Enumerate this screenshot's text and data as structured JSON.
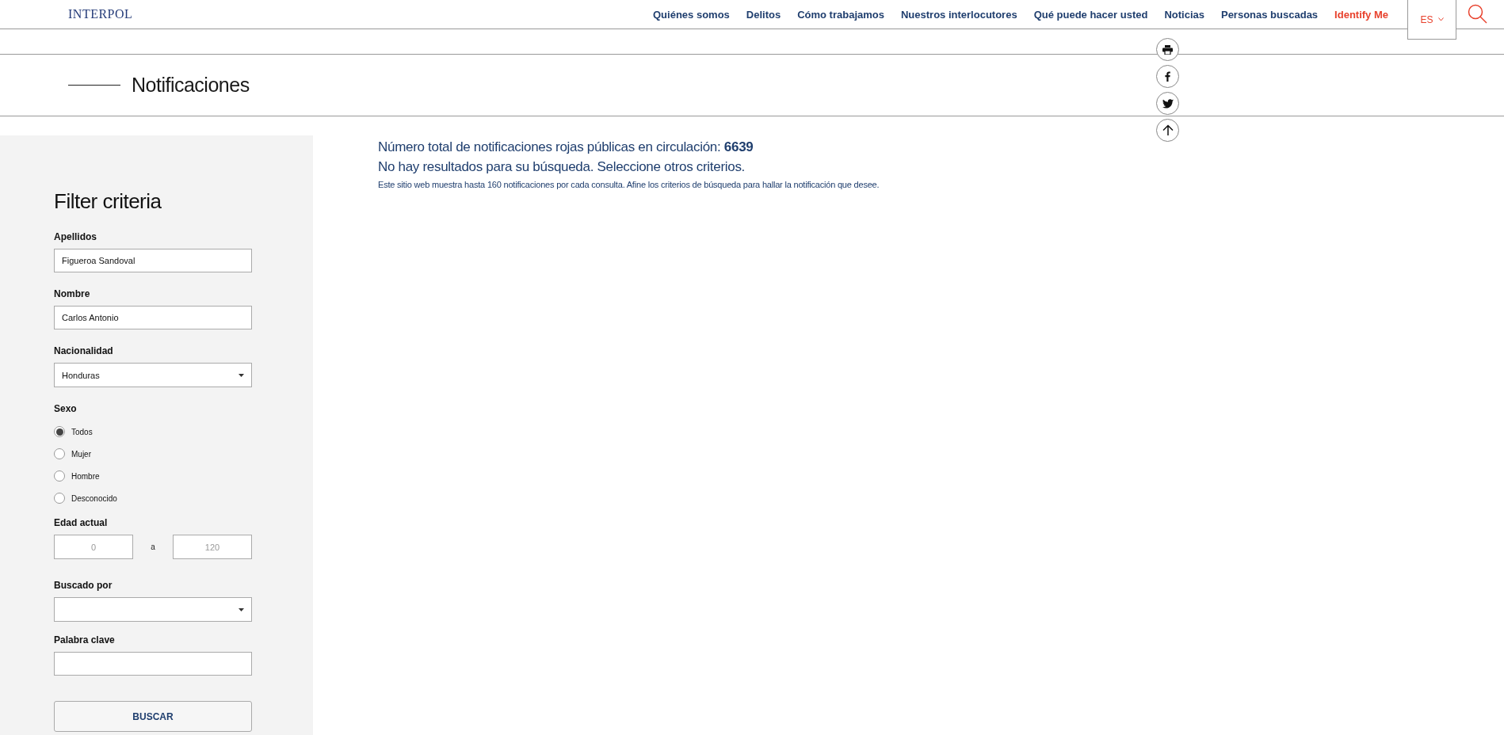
{
  "header": {
    "logo": "INTERPOL",
    "nav": [
      {
        "label": "Quiénes somos",
        "kind": "normal"
      },
      {
        "label": "Delitos",
        "kind": "normal"
      },
      {
        "label": "Cómo trabajamos",
        "kind": "normal"
      },
      {
        "label": "Nuestros interlocutores",
        "kind": "normal"
      },
      {
        "label": "Qué puede hacer usted",
        "kind": "normal"
      },
      {
        "label": "Noticias",
        "kind": "normal"
      },
      {
        "label": "Personas buscadas",
        "kind": "normal"
      },
      {
        "label": "Identify Me",
        "kind": "highlight"
      }
    ],
    "language": "ES"
  },
  "page_title": "Notificaciones",
  "filter": {
    "title": "Filter criteria",
    "surname": {
      "label": "Apellidos",
      "value": "Figueroa Sandoval"
    },
    "name": {
      "label": "Nombre",
      "value": "Carlos Antonio"
    },
    "nationality": {
      "label": "Nacionalidad",
      "value": "Honduras"
    },
    "sex": {
      "label": "Sexo",
      "options": [
        {
          "label": "Todos",
          "selected": true
        },
        {
          "label": "Mujer",
          "selected": false
        },
        {
          "label": "Hombre",
          "selected": false
        },
        {
          "label": "Desconocido",
          "selected": false
        }
      ]
    },
    "age": {
      "label": "Edad actual",
      "from_placeholder": "0",
      "separator": "a",
      "to_placeholder": "120"
    },
    "wanted_by": {
      "label": "Buscado por"
    },
    "keyword": {
      "label": "Palabra clave"
    },
    "button": "BUSCAR"
  },
  "results": {
    "total": "Número total de notificaciones rojas públicas en circulación: **6639**",
    "message": "No hay resultados para su búsqueda. Seleccione otros criterios.",
    "note": "Este sitio web muestra hasta 160 notificaciones por cada consulta. Afine los criterios de búsqueda para hallar la notificación que desee."
  }
}
